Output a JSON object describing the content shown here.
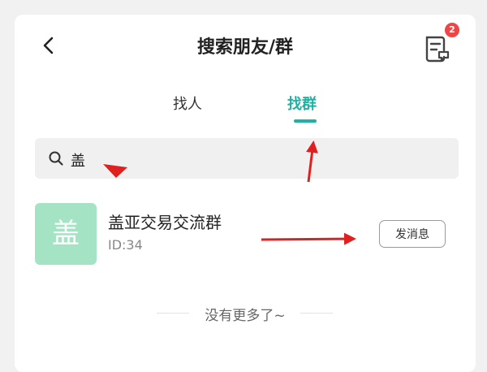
{
  "header": {
    "title": "搜索朋友/群",
    "badge_count": "2"
  },
  "tabs": [
    {
      "label": "找人",
      "active": false
    },
    {
      "label": "找群",
      "active": true
    }
  ],
  "search": {
    "value": "盖"
  },
  "result": {
    "avatar_char": "盖",
    "name": "盖亚交易交流群",
    "id_text": "ID:34",
    "action_label": "发消息"
  },
  "footer": {
    "end_text": "没有更多了~"
  },
  "colors": {
    "accent": "#1fb1a3",
    "avatar_bg": "#a4e3c4",
    "badge": "#f04545",
    "annotation_arrow": "#e0201f"
  },
  "icons": [
    "back-arrow-icon",
    "message-list-icon",
    "search-icon"
  ]
}
